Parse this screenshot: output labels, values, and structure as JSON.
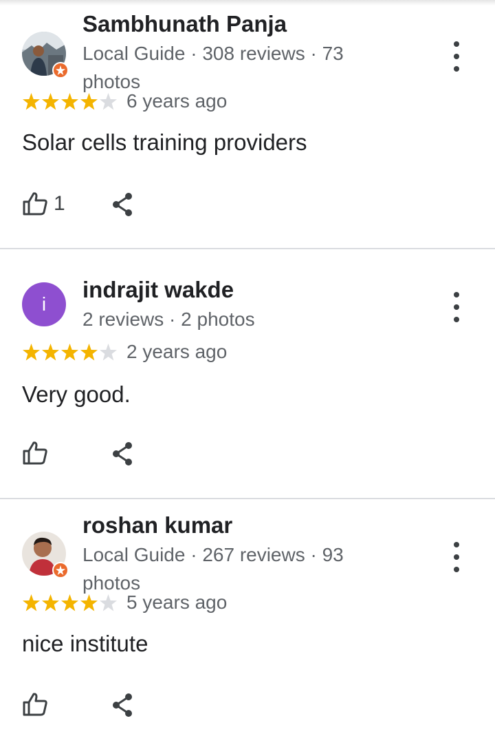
{
  "reviews": [
    {
      "name": "Sambhunath Panja",
      "meta": "Local Guide · 308 reviews · 73 photos",
      "rating": 4,
      "time": "6 years ago",
      "text": "Solar cells training providers",
      "likes": "1",
      "avatar_type": "photo",
      "local_guide": true
    },
    {
      "name": "indrajit wakde",
      "meta": "2 reviews · 2 photos",
      "rating": 4,
      "time": "2 years ago",
      "text": "Very good.",
      "likes": "",
      "avatar_type": "letter",
      "avatar_letter": "i",
      "avatar_color": "#8e4fd0",
      "local_guide": false
    },
    {
      "name": "roshan kumar",
      "meta": "Local Guide · 267 reviews · 93 photos",
      "rating": 4,
      "time": "5 years ago",
      "text": "nice institute",
      "likes": "",
      "avatar_type": "photo",
      "local_guide": true
    }
  ],
  "icons": {
    "like": "thumbs-up-icon",
    "share": "share-icon",
    "more": "more-vert-icon",
    "badge": "local-guide-badge-icon"
  },
  "colors": {
    "star_filled": "#f4b400",
    "star_empty": "#dadce0",
    "badge": "#ea6a2c"
  }
}
